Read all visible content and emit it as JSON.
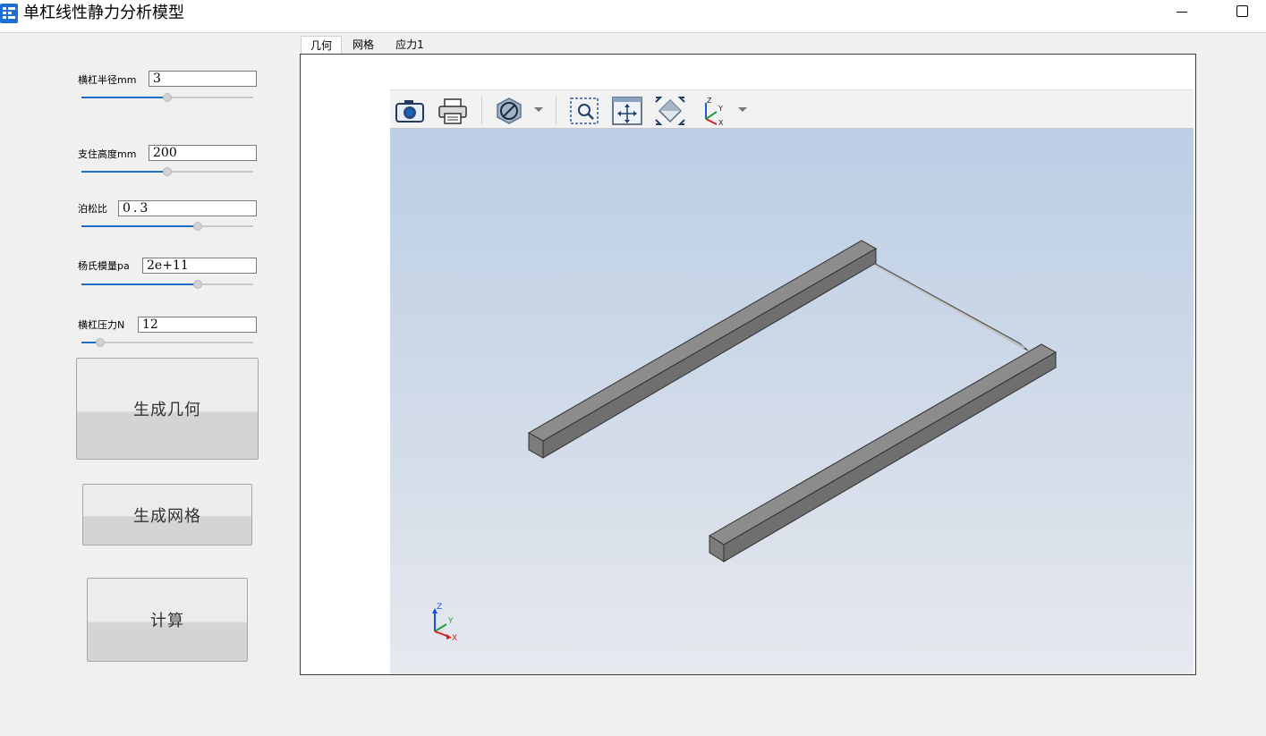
{
  "window": {
    "title": "单杠线性静力分析模型"
  },
  "params": [
    {
      "label": "横杠半径mm",
      "value": "3",
      "slider": 0.5
    },
    {
      "label": "支住高度mm",
      "value": "200",
      "slider": 0.5
    },
    {
      "label": "泊松比",
      "value": "0.3",
      "slider": 0.68
    },
    {
      "label": "杨氏模量pa",
      "value": "2e+11",
      "slider": 0.68
    },
    {
      "label": "横杠压力N",
      "value": "12",
      "slider": 0.11
    }
  ],
  "buttons": {
    "generate_geometry": "生成几何",
    "generate_mesh": "生成网格",
    "compute": "计算"
  },
  "tabs": [
    {
      "label": "几何",
      "active": true
    },
    {
      "label": "网格",
      "active": false
    },
    {
      "label": "应力1",
      "active": false
    }
  ],
  "toolbar_icons": [
    "camera-icon",
    "print-icon",
    "display-mode-icon",
    "zoom-box-icon",
    "fit-all-icon",
    "view-iso-icon",
    "axes-orientation-icon"
  ],
  "axis_labels": {
    "z": "Z",
    "y": "Y",
    "x": "X"
  },
  "colors": {
    "accent": "#1c6ec7",
    "bar": "#7a7a7a",
    "scene_top": "#bccfe6",
    "scene_bottom": "#e6e9ee"
  }
}
